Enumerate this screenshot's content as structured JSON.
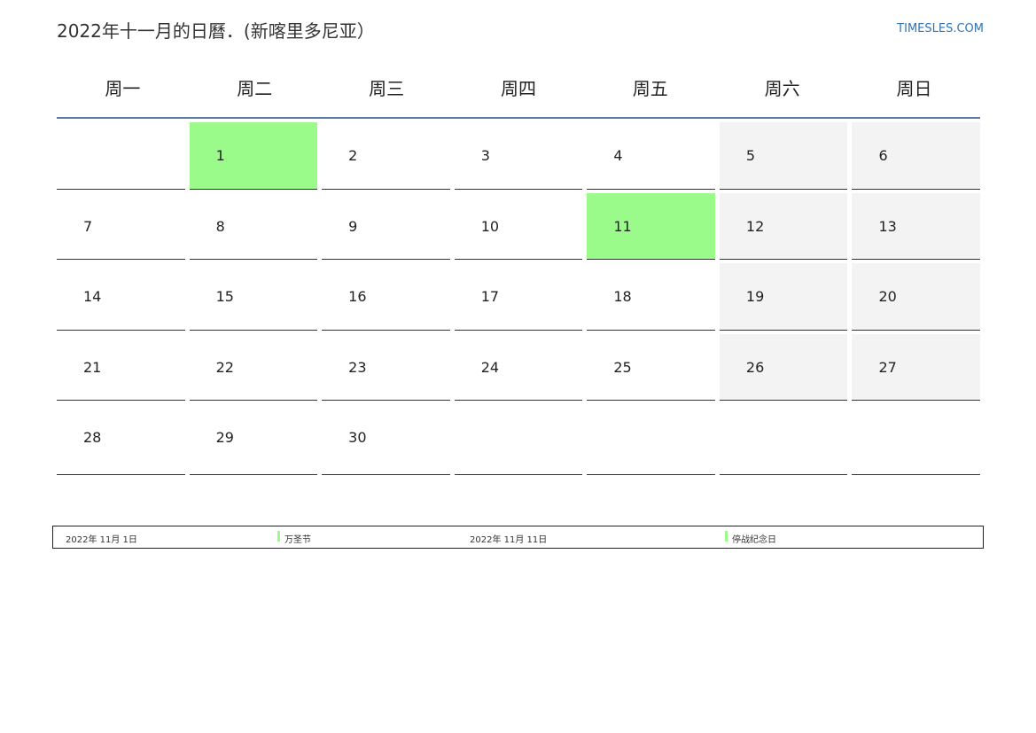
{
  "header": {
    "title": "2022年十一月的日曆．(新喀里多尼亚）",
    "site": "TIMESLES.COM"
  },
  "weekdays": [
    "周一",
    "周二",
    "周三",
    "周四",
    "周五",
    "周六",
    "周日"
  ],
  "weeks": [
    [
      "",
      "1",
      "2",
      "3",
      "4",
      "5",
      "6"
    ],
    [
      "7",
      "8",
      "9",
      "10",
      "11",
      "12",
      "13"
    ],
    [
      "14",
      "15",
      "16",
      "17",
      "18",
      "19",
      "20"
    ],
    [
      "21",
      "22",
      "23",
      "24",
      "25",
      "26",
      "27"
    ],
    [
      "28",
      "29",
      "30",
      "",
      "",
      "",
      ""
    ]
  ],
  "highlight_colors": {
    "holiday": "#9afb8b",
    "weekend": "#f3f3f3",
    "header_rule": "#5b7ba0",
    "site_link": "#2f75b5"
  },
  "holidays": [
    {
      "date": "2022年 11月 1日",
      "name": "万圣节"
    },
    {
      "date": "2022年 11月 11日",
      "name": "停战纪念日"
    }
  ]
}
